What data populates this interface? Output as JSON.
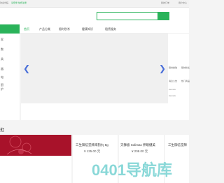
{
  "topbar": {
    "left_text": "欢迎光临",
    "green_link": "请登录 免费注册",
    "right_1": "我的订单",
    "right_2": "用户中心"
  },
  "search": {
    "placeholder": ""
  },
  "nav": {
    "items": [
      "首页",
      "产品分类",
      "限时秒杀",
      "健康知识",
      "租赁服务"
    ],
    "active_index": 0,
    "accent_color": "#2ab35a"
  },
  "sidebar": {
    "items": [
      "家",
      "数",
      "具",
      "器",
      "电",
      "厨",
      "护"
    ]
  },
  "banner": {
    "prev_symbol": "❮",
    "next_symbol": "❯",
    "arrow_color": "#4a6fd9"
  },
  "right_panel": {
    "rows": [
      "限时抢购",
      "限时秒杀",
      "消息公告",
      "热门商品",
      "xxx.xxx",
      "xxx.xxx"
    ]
  },
  "section": {
    "title": "逛"
  },
  "products": [
    {
      "name": "三生御信堂牌海狗丸 8g",
      "price": "¥ 135.00 元"
    },
    {
      "name": "天狮极 Solimax 养眼健美",
      "price": "¥ 208.00 元"
    },
    {
      "name": "三生御信堂牌",
      "price": "¥ 135.00 元"
    }
  ],
  "watermark": {
    "text": "0401导航库"
  }
}
